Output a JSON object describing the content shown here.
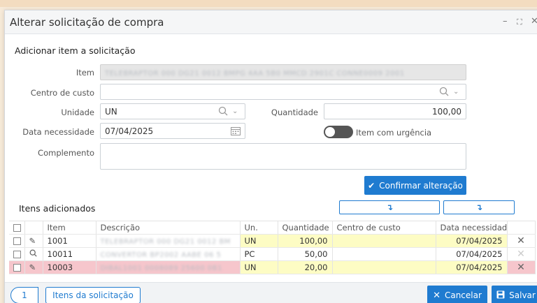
{
  "window": {
    "title": "Alterar solicitação de compra",
    "controls": [
      "–",
      "⛶",
      "✕"
    ]
  },
  "form": {
    "section_title": "Adicionar item a solicitação",
    "item_label": "Item",
    "item_value": "TELEBRAPTOR 000 DG21 0012 BMPG 4AA 5B0 MMCD 2901C CONNE0009 2001",
    "centro_label": "Centro de custo",
    "centro_value": "",
    "unidade_label": "Unidade",
    "unidade_value": "UN",
    "quantidade_label": "Quantidade",
    "quantidade_value": "100,00",
    "data_label": "Data necessidade",
    "data_value": "07/04/2025",
    "urgencia_label": "Item com urgência",
    "complemento_label": "Complemento",
    "complemento_value": "",
    "confirm_button": "Confirmar alteração"
  },
  "items": {
    "section_title": "Itens adicionados",
    "columns": [
      "Item",
      "Descrição",
      "Un.",
      "Quantidade",
      "Centro de custo",
      "Data necessidade"
    ],
    "rows": [
      {
        "item": "1001",
        "descricao": "TELEBRAPTOR 000 DG21 0012 BM",
        "un": "UN",
        "quantidade": "100,00",
        "centro": "",
        "data": "07/04/2025"
      },
      {
        "item": "10011",
        "descricao": "CONVERTOR BP2002 AABE 06 5",
        "un": "PC",
        "quantidade": "50,00",
        "centro": "",
        "data": "07/04/2025"
      },
      {
        "item": "10003",
        "descricao": "DIBAL1001 0008089 25600 0B1",
        "un": "UN",
        "quantidade": "20,00",
        "centro": "",
        "data": "07/04/2025"
      }
    ]
  },
  "footer": {
    "count": "1",
    "items_button": "Itens da solicitação",
    "cancel_button": "Cancelar",
    "save_button": "Salvar"
  }
}
